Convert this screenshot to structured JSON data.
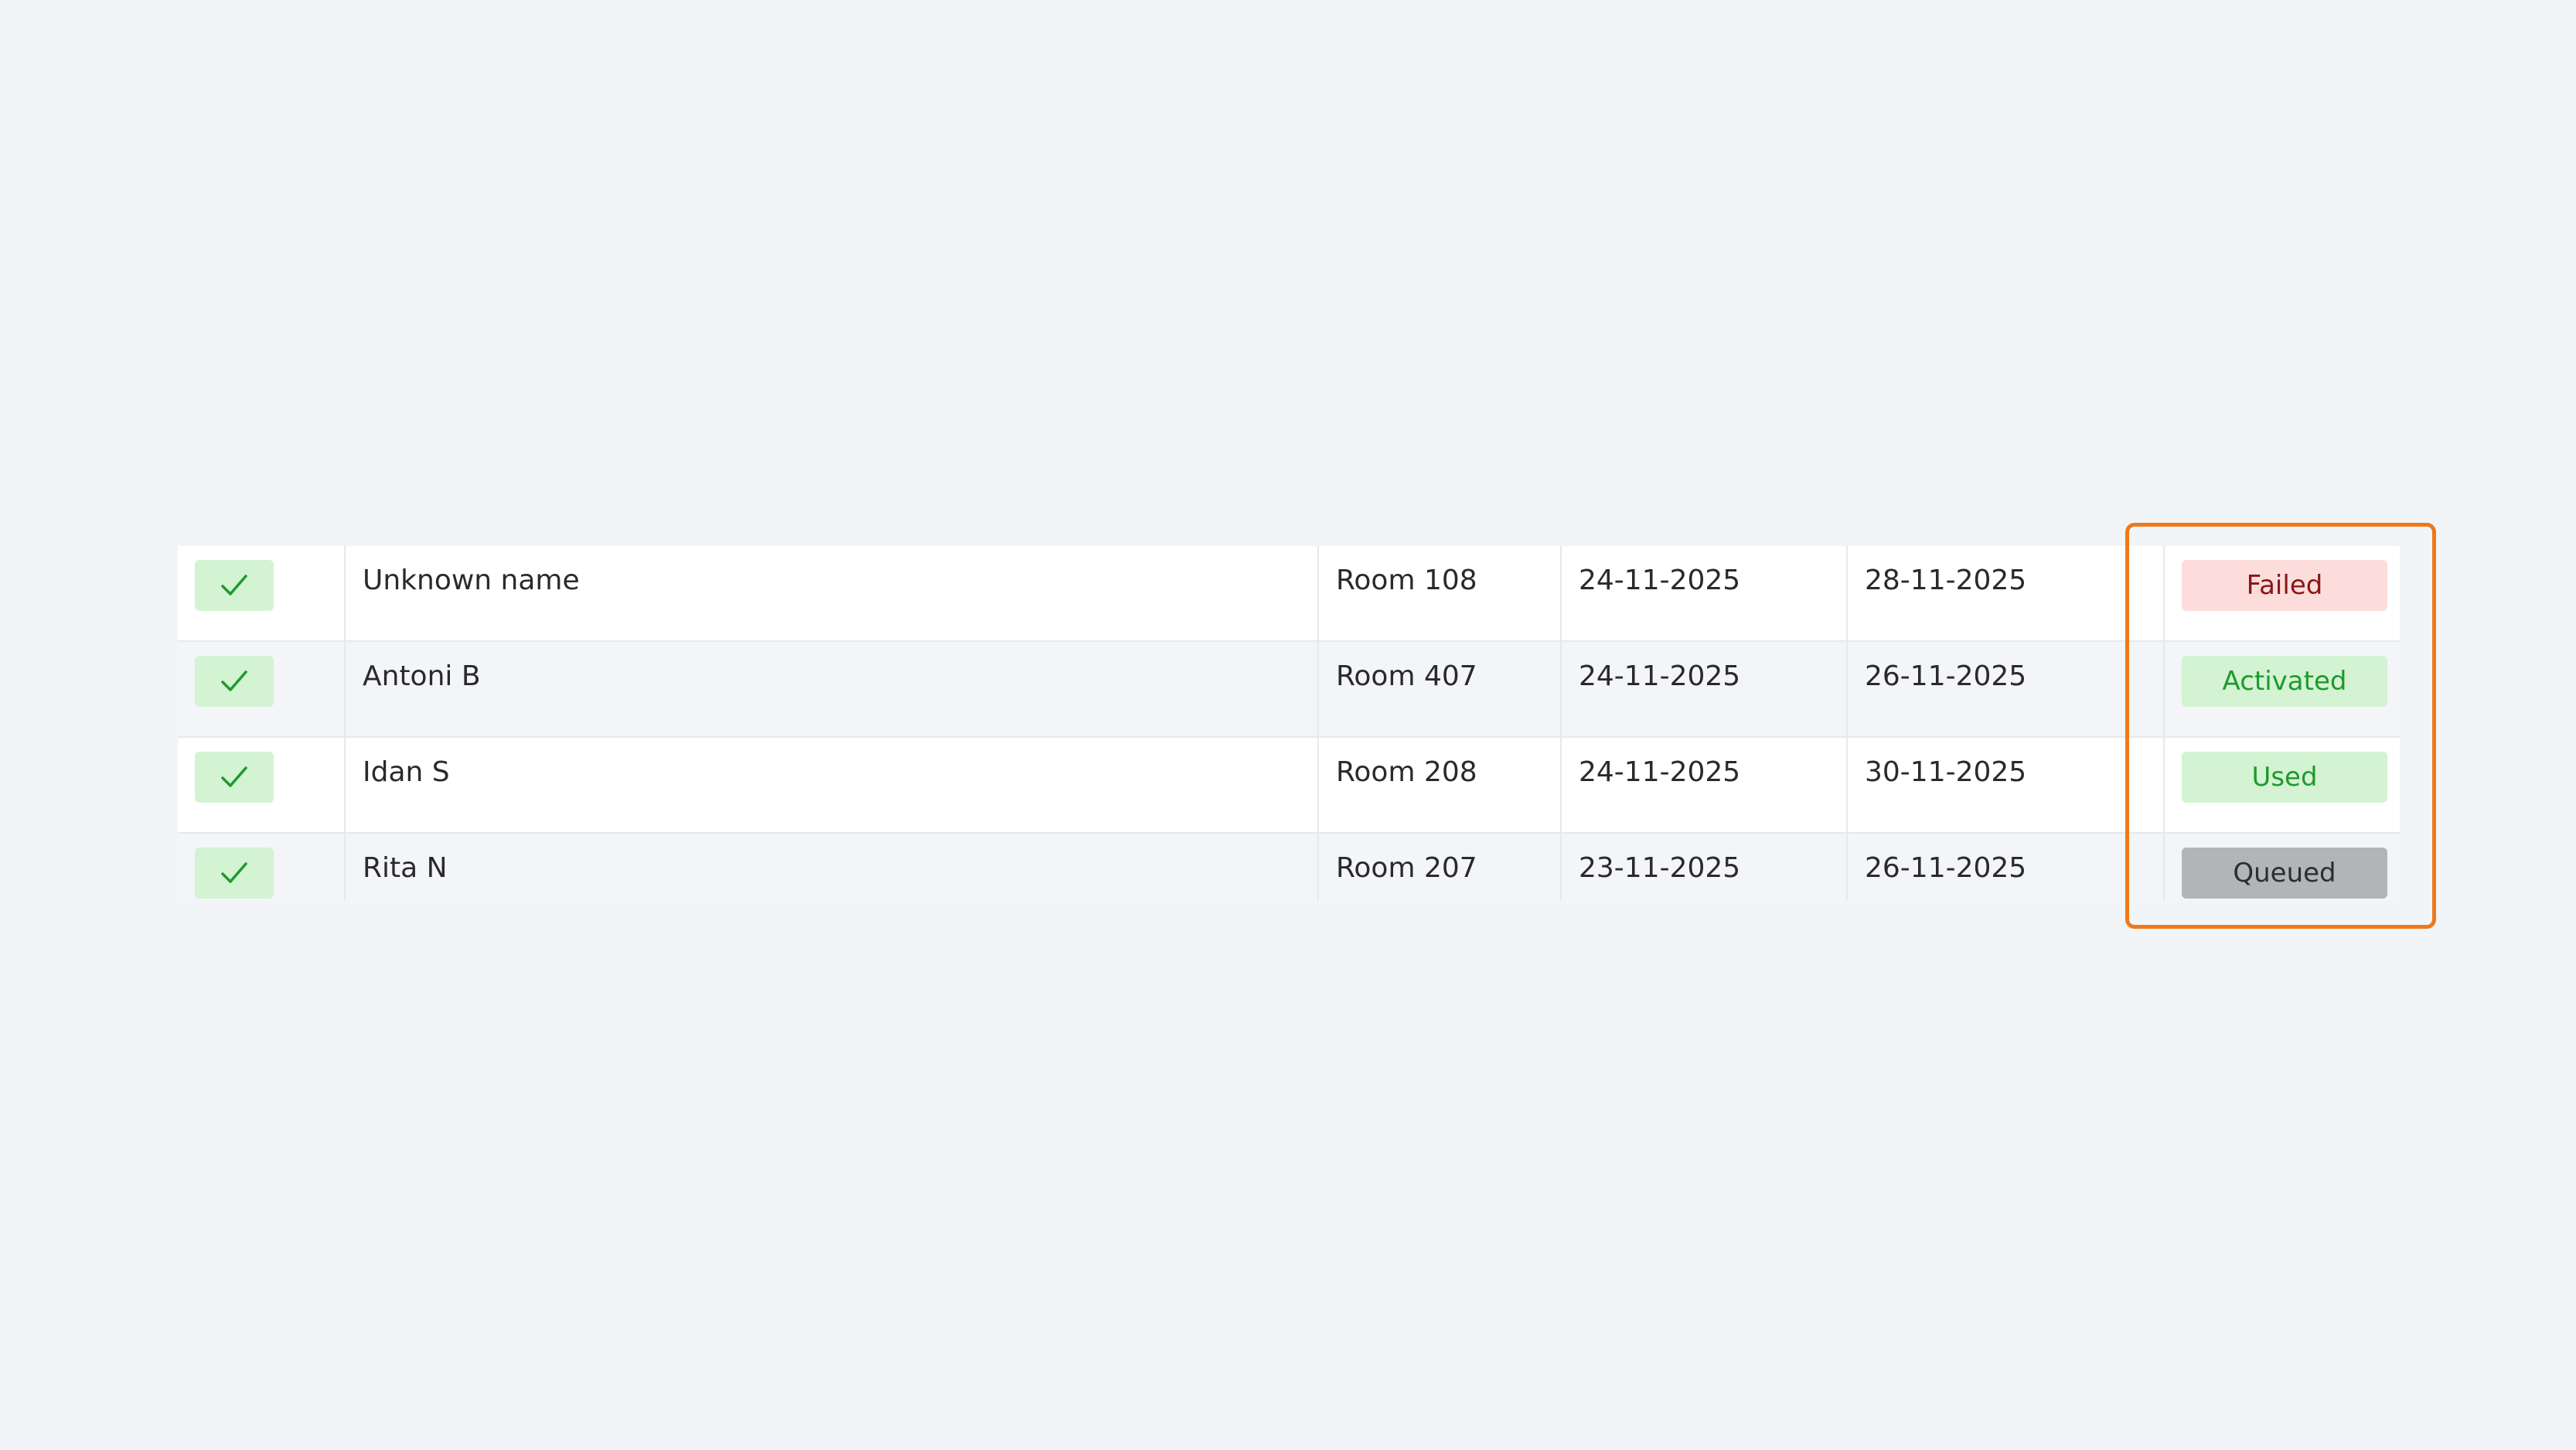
{
  "rows": [
    {
      "name": "Unknown name",
      "room": "Room 108",
      "check_in": "24-11-2025",
      "check_out": "28-11-2025",
      "status": "Failed",
      "status_color": "#fddcdc"
    },
    {
      "name": "Antoni B",
      "room": "Room 407",
      "check_in": "24-11-2025",
      "check_out": "26-11-2025",
      "status": "Activated",
      "status_color": "#d3f3d3"
    },
    {
      "name": "Idan S",
      "room": "Room 208",
      "check_in": "24-11-2025",
      "check_out": "30-11-2025",
      "status": "Used",
      "status_color": "#d3f3d3"
    },
    {
      "name": "Rita N",
      "room": "Room 207",
      "check_in": "23-11-2025",
      "check_out": "26-11-2025",
      "status": "Queued",
      "status_color": "#b3b4b7"
    }
  ],
  "icons": {
    "row_check": "checkmark-icon"
  },
  "colors": {
    "highlight": "#f07818",
    "check_green": "#1f9a2b",
    "page_background": "#f2f5f8"
  }
}
